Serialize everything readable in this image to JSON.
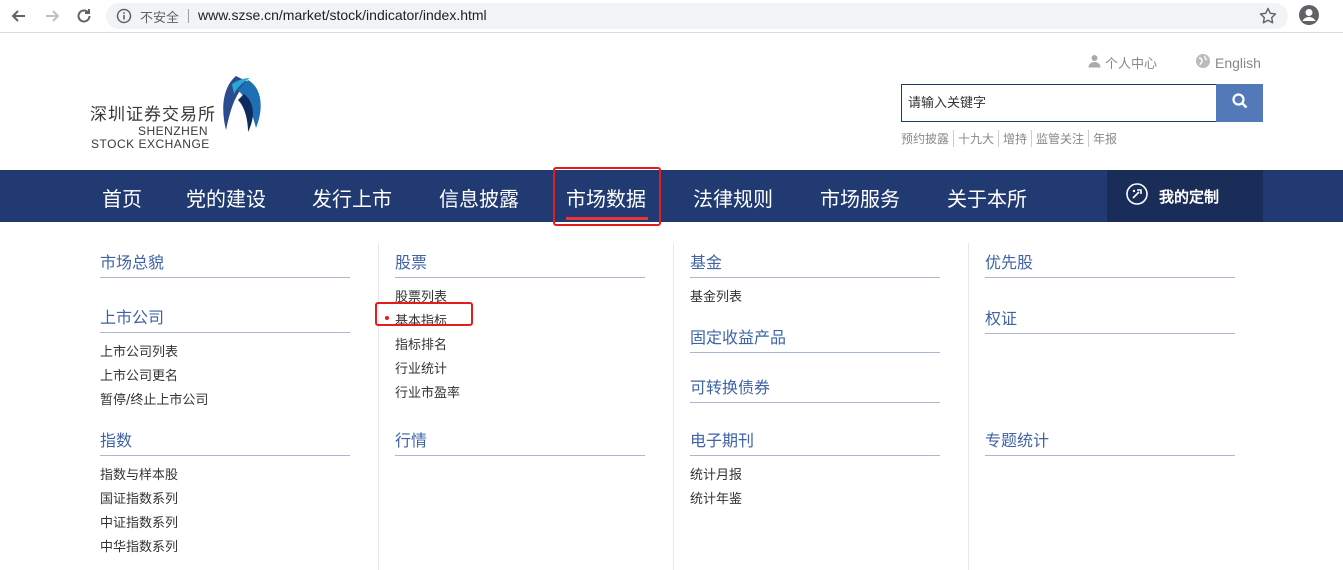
{
  "browser": {
    "insecure_label": "不安全",
    "url": "www.szse.cn/market/stock/indicator/index.html"
  },
  "logo": {
    "cn": "深圳证券交易所",
    "en_line1": "SHENZHEN",
    "en_line2": "STOCK EXCHANGE"
  },
  "top_links": {
    "personal": "个人中心",
    "english": "English"
  },
  "search": {
    "placeholder": "请输入关键字"
  },
  "hot_words": [
    "预约披露",
    "十九大",
    "增持",
    "监管关注",
    "年报"
  ],
  "nav": {
    "items": [
      "首页",
      "党的建设",
      "发行上市",
      "信息披露",
      "市场数据",
      "法律规则",
      "市场服务",
      "关于本所"
    ],
    "active": "市场数据",
    "custom": "我的定制"
  },
  "menu": {
    "col1": {
      "s1": {
        "title": "市场总貌",
        "items": []
      },
      "s2": {
        "title": "上市公司",
        "items": [
          "上市公司列表",
          "上市公司更名",
          "暂停/终止上市公司"
        ]
      },
      "s3": {
        "title": "指数",
        "items": [
          "指数与样本股",
          "国证指数系列",
          "中证指数系列",
          "中华指数系列"
        ]
      }
    },
    "col2": {
      "s1": {
        "title": "股票",
        "items": [
          "股票列表",
          "基本指标",
          "指标排名",
          "行业统计",
          "行业市盈率"
        ]
      },
      "s2": {
        "title": "行情",
        "items": []
      }
    },
    "col3": {
      "s1": {
        "title": "基金",
        "items": [
          "基金列表"
        ]
      },
      "s2": {
        "title": "固定收益产品",
        "items": []
      },
      "s3": {
        "title": "可转换债券",
        "items": []
      },
      "s4": {
        "title": "电子期刊",
        "items": [
          "统计月报",
          "统计年鉴"
        ]
      }
    },
    "col4": {
      "s1": {
        "title": "优先股",
        "items": []
      },
      "s2": {
        "title": "权证",
        "items": []
      },
      "s3": {
        "title": "专题统计",
        "items": []
      }
    },
    "current": "基本指标"
  },
  "colors": {
    "nav_bg": "#213a72",
    "accent_blue": "#3f63a6",
    "highlight_red": "#e51c1c"
  }
}
